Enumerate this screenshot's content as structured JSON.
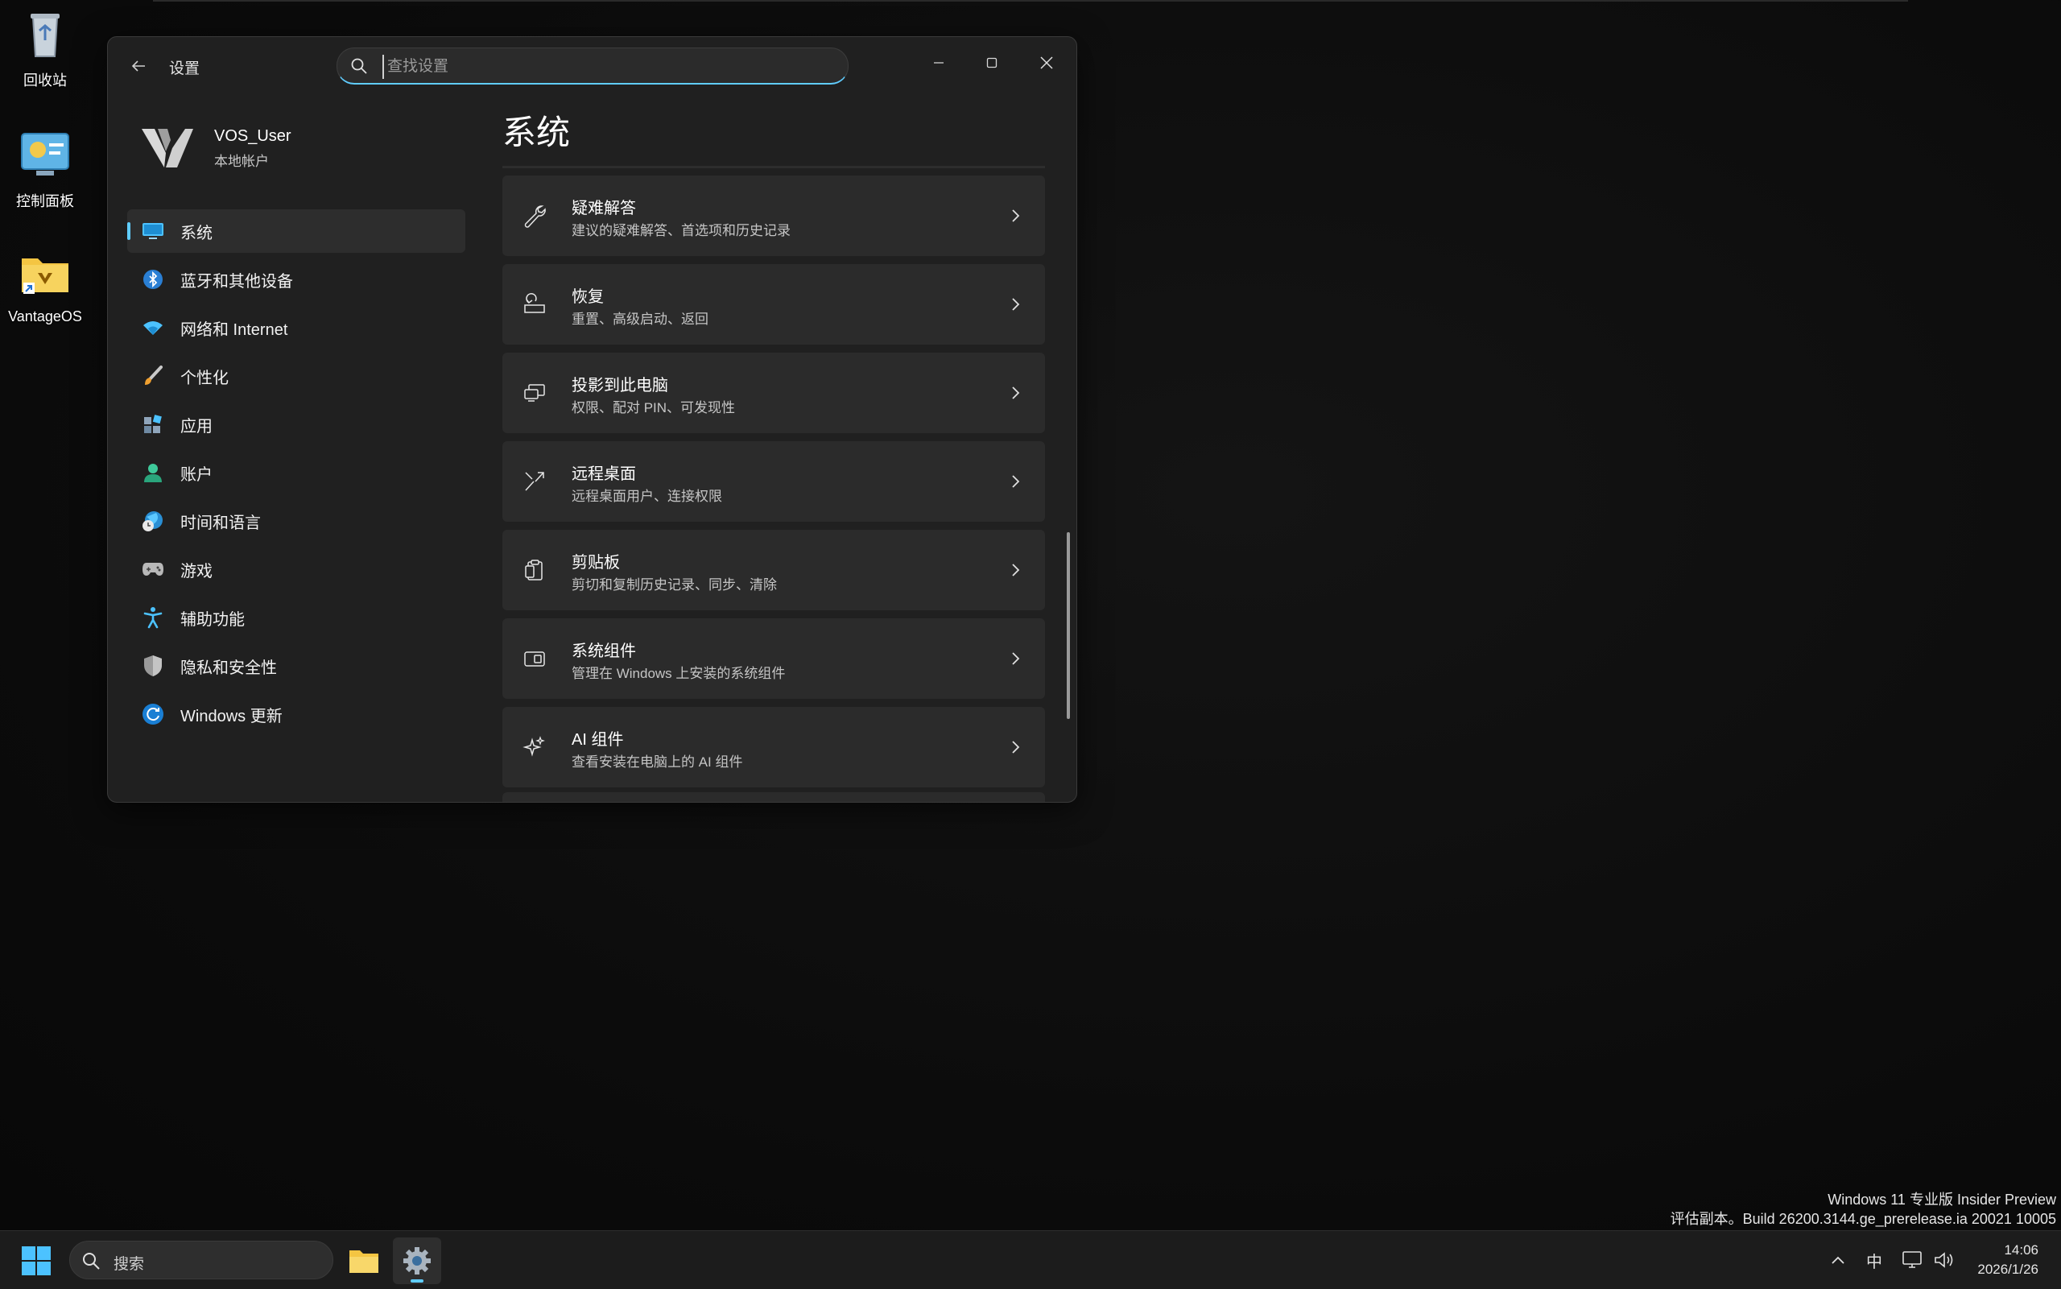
{
  "desktop": {
    "icons": [
      {
        "label": "回收站",
        "icon": "recycle-bin-icon"
      },
      {
        "label": "控制面板",
        "icon": "control-panel-icon"
      },
      {
        "label": "VantageOS",
        "icon": "folder-shortcut-icon"
      }
    ],
    "watermark_line1": "Windows 11 专业版 Insider Preview",
    "watermark_line2": "评估副本。Build 26200.3144.ge_prerelease.ia 20021 10005"
  },
  "settings": {
    "app_title": "设置",
    "search_placeholder": "查找设置",
    "window_controls": {
      "minimize": "minimize-icon",
      "maximize": "maximize-icon",
      "close": "close-icon"
    },
    "profile": {
      "name": "VOS_User",
      "type": "本地帐户"
    },
    "nav": [
      {
        "label": "系统",
        "icon": "monitor-icon",
        "active": true
      },
      {
        "label": "蓝牙和其他设备",
        "icon": "bluetooth-icon"
      },
      {
        "label": "网络和 Internet",
        "icon": "wifi-icon"
      },
      {
        "label": "个性化",
        "icon": "brush-icon"
      },
      {
        "label": "应用",
        "icon": "apps-icon"
      },
      {
        "label": "账户",
        "icon": "person-icon"
      },
      {
        "label": "时间和语言",
        "icon": "globe-clock-icon"
      },
      {
        "label": "游戏",
        "icon": "gamepad-icon"
      },
      {
        "label": "辅助功能",
        "icon": "accessibility-icon"
      },
      {
        "label": "隐私和安全性",
        "icon": "shield-icon"
      },
      {
        "label": "Windows 更新",
        "icon": "update-icon"
      }
    ],
    "page_title": "系统",
    "cards": [
      {
        "title": "疑难解答",
        "subtitle": "建议的疑难解答、首选项和历史记录",
        "icon": "wrench-icon"
      },
      {
        "title": "恢复",
        "subtitle": "重置、高级启动、返回",
        "icon": "recovery-icon"
      },
      {
        "title": "投影到此电脑",
        "subtitle": "权限、配对 PIN、可发现性",
        "icon": "projection-icon"
      },
      {
        "title": "远程桌面",
        "subtitle": "远程桌面用户、连接权限",
        "icon": "remote-desktop-icon"
      },
      {
        "title": "剪贴板",
        "subtitle": "剪切和复制历史记录、同步、清除",
        "icon": "clipboard-icon"
      },
      {
        "title": "系统组件",
        "subtitle": "管理在 Windows 上安装的系统组件",
        "icon": "system-components-icon"
      },
      {
        "title": "AI 组件",
        "subtitle": "查看安装在电脑上的 AI 组件",
        "icon": "ai-sparkle-icon"
      }
    ]
  },
  "taskbar": {
    "search_label": "搜索",
    "ime_label": "中",
    "time": "14:06",
    "date": "2026/1/26"
  },
  "colors": {
    "accent": "#60cdff",
    "window_bg": "#202020",
    "card_bg": "#2b2b2b",
    "desktop_bg": "#0c0c0c"
  }
}
